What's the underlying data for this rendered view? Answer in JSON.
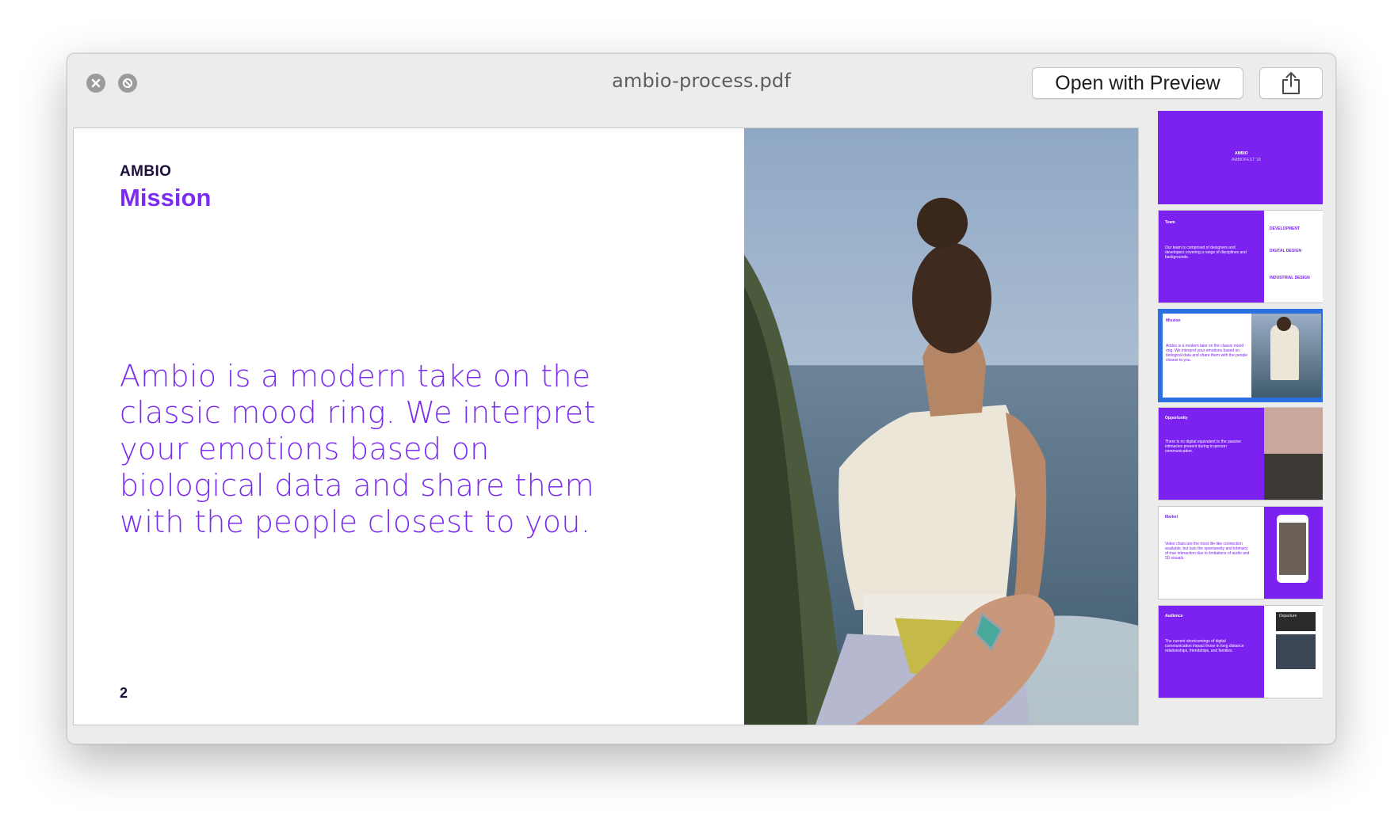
{
  "window": {
    "title": "ambio-process.pdf",
    "open_with_label": "Open with Preview",
    "share_icon": "share-icon"
  },
  "page": {
    "brand": "AMBIO",
    "section_title": "Mission",
    "body": "Ambio is a modern take on the classic mood ring. We interpret your emotions based on biological data and share them with the people closest to you.",
    "page_number": "2"
  },
  "thumbnails": [
    {
      "title": "AMBIO",
      "subtitle": "AMBIOFEST '18"
    },
    {
      "title": "Team",
      "body": "Our team is comprised of designers and developers covering a range of disciplines and backgrounds.",
      "sidebar_head1": "DEVELOPMENT",
      "sidebar_head2": "DIGITAL DESIGN",
      "sidebar_head3": "INDUSTRIAL DESIGN"
    },
    {
      "title": "Mission",
      "body": "Ambio is a modern take on the classic mood ring. We interpret your emotions based on biological data and share them with the people closest to you."
    },
    {
      "title": "Opportunity",
      "body": "There is no digital equivalent to the passive intimacies present during in-person communication."
    },
    {
      "title": "Market",
      "body": "Video chats are the most life-like connection available, but lack the spontaneity and intimacy of true interaction due to limitations of audio and 2D visuals."
    },
    {
      "title": "Audience",
      "body": "The current shortcomings of digital communication impact those in long distance relationships, friendships, and families.",
      "photo_label": "Departure"
    }
  ],
  "colors": {
    "accent": "#7b2cee",
    "dark": "#1d0d3b",
    "selection": "#2c6fe0"
  }
}
